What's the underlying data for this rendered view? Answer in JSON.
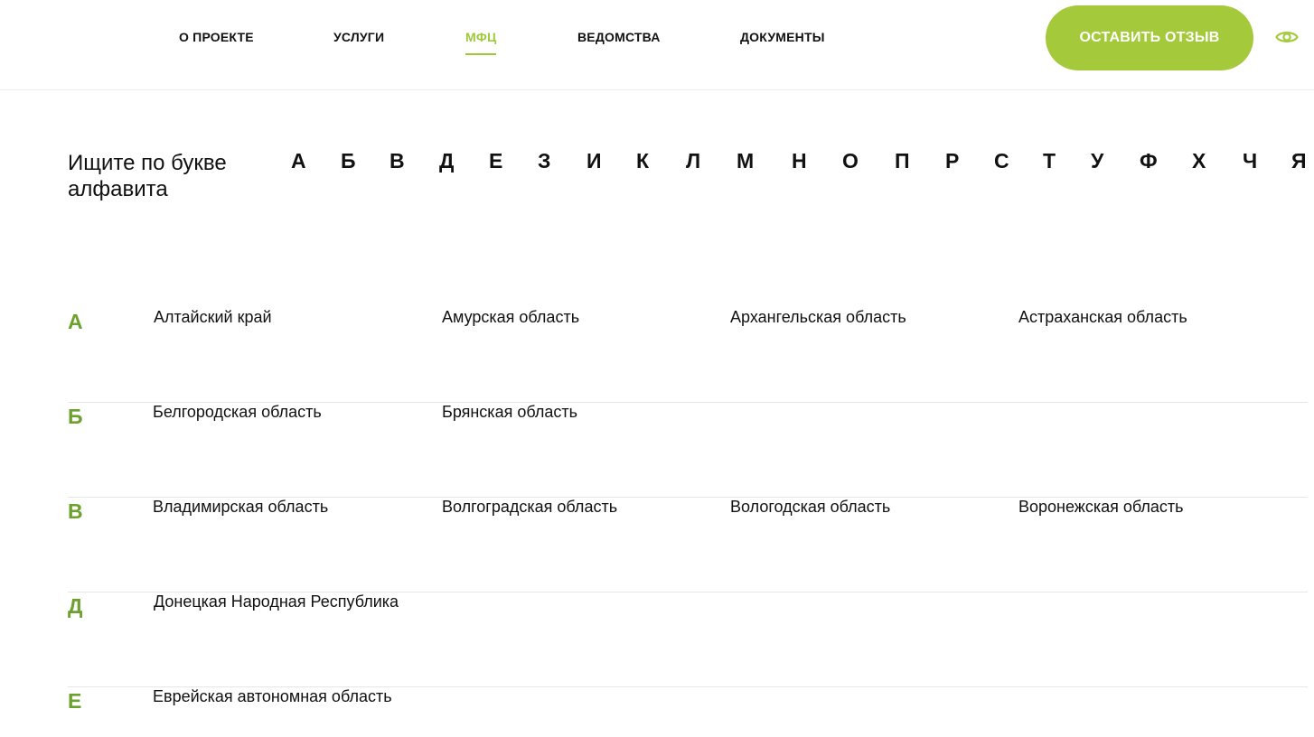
{
  "header": {
    "nav": [
      {
        "label": "О ПРОЕКТЕ"
      },
      {
        "label": "УСЛУГИ"
      },
      {
        "label": "МФЦ"
      },
      {
        "label": "ВЕДОМСТВА"
      },
      {
        "label": "ДОКУМЕНТЫ"
      }
    ],
    "active_nav": "МФЦ",
    "cta_label": "ОСТАВИТЬ ОТЗЫВ",
    "accessibility_icon": "eye-icon"
  },
  "alphabet": {
    "title": "Ищите по букве алфавита",
    "letters": [
      "А",
      "Б",
      "В",
      "Д",
      "Е",
      "З",
      "И",
      "К",
      "Л",
      "М",
      "Н",
      "О",
      "П",
      "Р",
      "С",
      "Т",
      "У",
      "Ф",
      "Х",
      "Ч",
      "Я"
    ]
  },
  "groups": [
    {
      "letter": "А",
      "regions": [
        "Алтайский край",
        "Амурская область",
        "Архангельская область",
        "Астраханская область"
      ]
    },
    {
      "letter": "Б",
      "regions": [
        "Белгородская область",
        "Брянская область"
      ]
    },
    {
      "letter": "В",
      "regions": [
        "Владимирская область",
        "Волгоградская область",
        "Вологодская область",
        "Воронежская область"
      ]
    },
    {
      "letter": "Д",
      "regions": [
        "Донецкая Народная Республика"
      ]
    },
    {
      "letter": "Е",
      "regions": [
        "Еврейская автономная область"
      ]
    }
  ],
  "colors": {
    "accent": "#a4ca3c",
    "active_nav": "#9ec93a",
    "group_letter": "#6ca12e",
    "text": "#111111",
    "divider": "#e6e6e6"
  }
}
